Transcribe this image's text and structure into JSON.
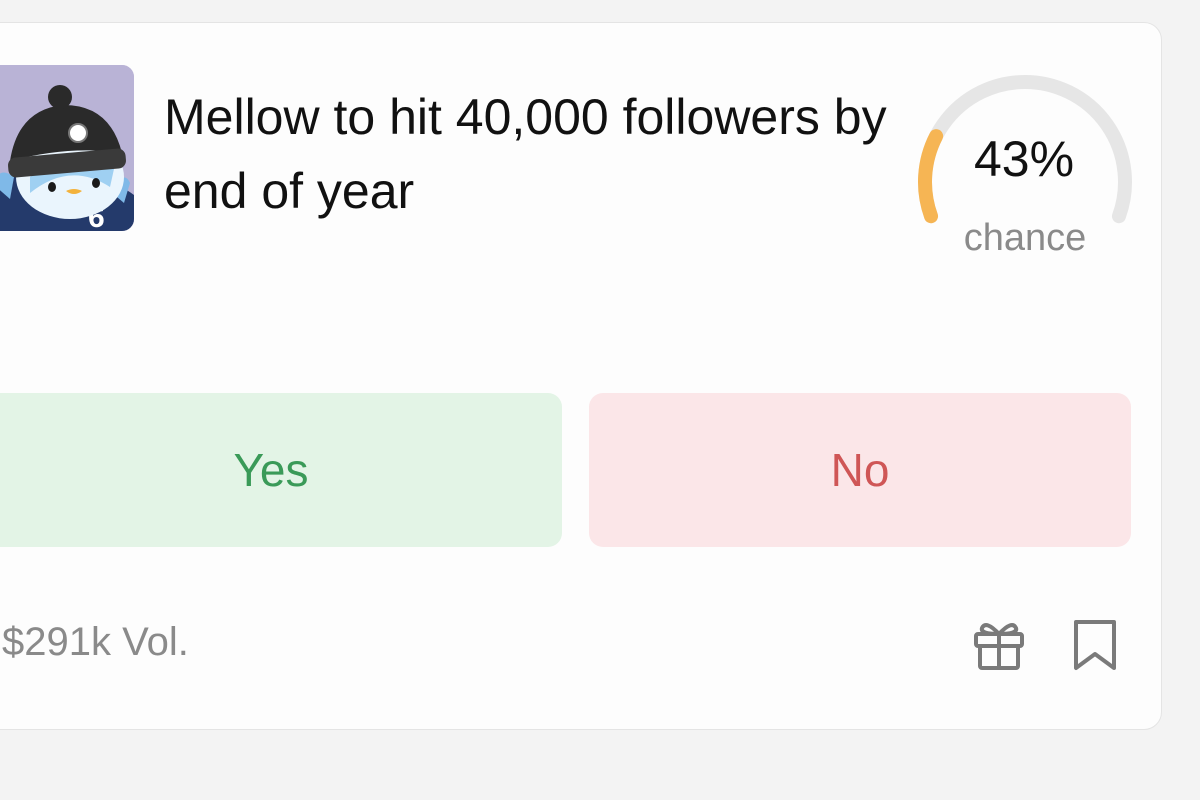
{
  "market": {
    "title": "Mellow to hit 40,000 followers by end of year",
    "chance_percent": "43%",
    "chance_label": "chance",
    "chance_value": 0.43,
    "volume": "$291k Vol."
  },
  "buttons": {
    "yes": "Yes",
    "no": "No"
  },
  "icons": {
    "avatar": "penguin-avatar",
    "gift": "gift-icon",
    "bookmark": "bookmark-icon"
  },
  "colors": {
    "gauge_fill": "#f6b554",
    "gauge_track": "#e6e6e6",
    "yes_text": "#3a9a58",
    "yes_bg": "#e3f4e6",
    "no_text": "#cf5656",
    "no_bg": "#fbe6e8"
  }
}
